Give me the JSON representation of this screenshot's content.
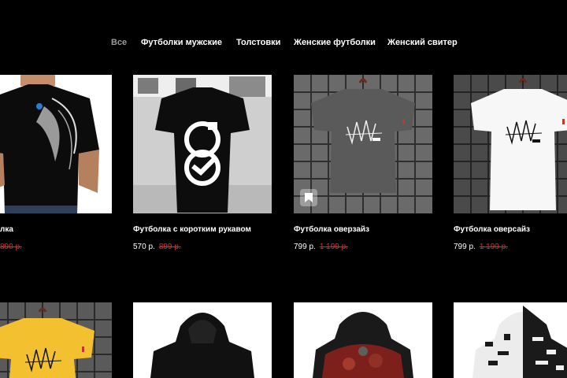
{
  "nav": {
    "tabs": [
      {
        "label": "Все",
        "active": true
      },
      {
        "label": "Футболки мужские",
        "active": false
      },
      {
        "label": "Толстовки",
        "active": false
      },
      {
        "label": "Женские футболки",
        "active": false
      },
      {
        "label": "Женский свитер",
        "active": false
      }
    ]
  },
  "products": [
    {
      "title": "лка",
      "price": "",
      "old_price": "890 р."
    },
    {
      "title": "Футболка с коротким рукавом",
      "price": "570 р.",
      "old_price": "899 р."
    },
    {
      "title": "Футболка оверзайз",
      "price": "799 р.",
      "old_price": "1 199 р."
    },
    {
      "title": "Футболка оверсайз",
      "price": "799 р.",
      "old_price": "1 199 р."
    }
  ],
  "colors": {
    "background": "#000000",
    "active_tab": "#9c9c9c",
    "old_price": "#e02b2b"
  }
}
